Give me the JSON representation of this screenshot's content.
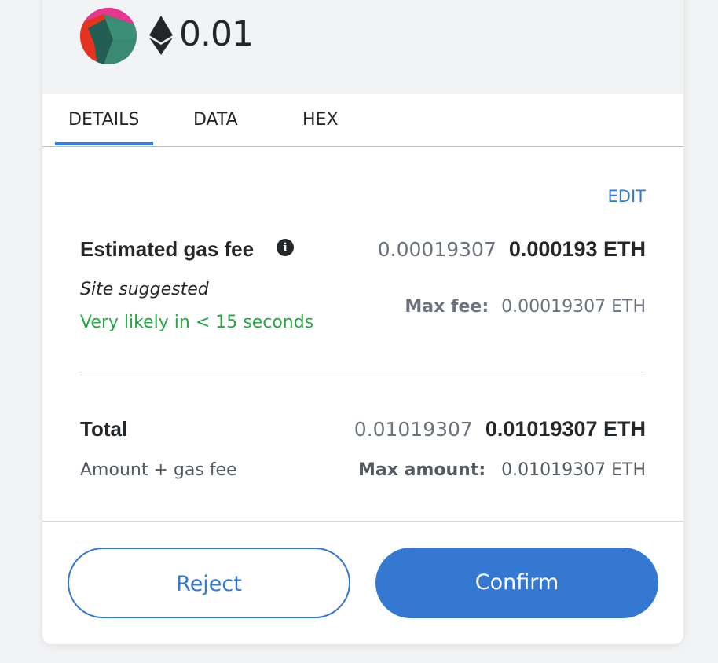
{
  "header": {
    "amount": "0.01",
    "asset_icon": "ethereum-icon",
    "avatar_icon": "account-jazzicon"
  },
  "tabs": [
    {
      "label": "DETAILS",
      "active": true
    },
    {
      "label": "DATA",
      "active": false
    },
    {
      "label": "HEX",
      "active": false
    }
  ],
  "details": {
    "edit_label": "EDIT",
    "gas_fee": {
      "label": "Estimated gas fee",
      "info_icon": "info-icon",
      "value_secondary": "0.00019307",
      "value_primary": "0.000193 ETH",
      "source": "Site suggested",
      "likelihood": "Very likely in < 15 seconds",
      "max_fee_label": "Max fee:",
      "max_fee_value": "0.00019307 ETH"
    },
    "total": {
      "label": "Total",
      "value_secondary": "0.01019307",
      "value_primary": "0.01019307 ETH",
      "sublabel": "Amount + gas fee",
      "max_amount_label": "Max amount:",
      "max_amount_value": "0.01019307 ETH"
    }
  },
  "footer": {
    "reject_label": "Reject",
    "confirm_label": "Confirm"
  },
  "colors": {
    "accent": "#3478d1",
    "success": "#28a745",
    "text": "#24272a",
    "muted": "#6a737d"
  }
}
